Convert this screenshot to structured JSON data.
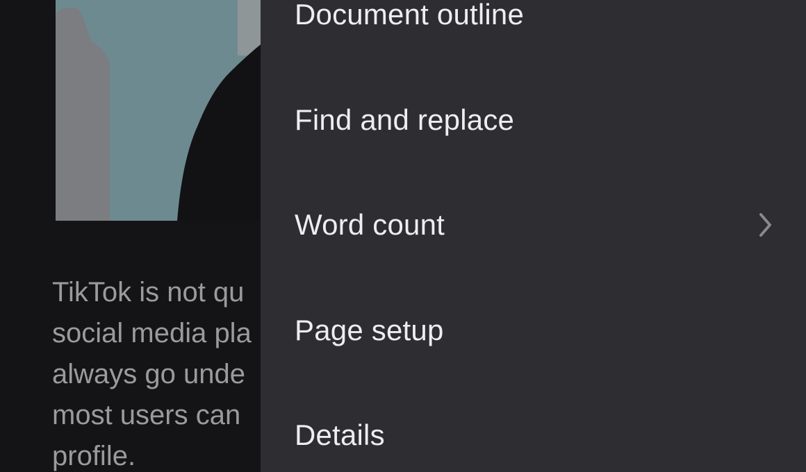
{
  "document": {
    "paragraph_lines": [
      "TikTok is not qu",
      "social media pla",
      "always go unde",
      "most users can",
      "profile."
    ]
  },
  "menu": {
    "items": [
      {
        "label": "Document outline",
        "has_submenu": false
      },
      {
        "label": "Find and replace",
        "has_submenu": false
      },
      {
        "label": "Word count",
        "has_submenu": true
      },
      {
        "label": "Page setup",
        "has_submenu": false
      },
      {
        "label": "Details",
        "has_submenu": false
      }
    ]
  },
  "colors": {
    "menu_background": "#2e2d32",
    "document_background": "#141416",
    "menu_text": "#eeeeee",
    "document_text": "#9b9b9b",
    "chevron": "#8a898e"
  },
  "icons": {
    "submenu": "chevron-right-icon"
  }
}
